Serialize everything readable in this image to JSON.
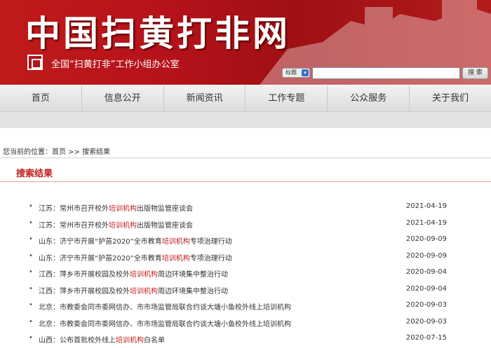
{
  "header": {
    "site_title": "中国扫黄打非网",
    "subtitle": "全国“扫黄打非”工作小组办公室",
    "search_scope": "标题",
    "search_value": "",
    "search_button": "搜 索"
  },
  "nav": [
    "首页",
    "信息公开",
    "新闻资讯",
    "工作专题",
    "公众服务",
    "关于我们"
  ],
  "breadcrumb": "您当前的位置：首页 >> 搜索结果",
  "section_title": "搜索结果",
  "results": [
    {
      "pre": "江苏：常州市召开校外",
      "hl": "培训机构",
      "post": "出版物监管座谈会",
      "date": "2021-04-19"
    },
    {
      "pre": "江苏：常州市召开校外",
      "hl": "培训机构",
      "post": "出版物监管座谈会",
      "date": "2021-04-19"
    },
    {
      "pre": "山东：济宁市开展“护苗2020”全市教育",
      "hl": "培训机构",
      "post": "专项治理行动",
      "date": "2020-09-09"
    },
    {
      "pre": "山东：济宁市开展“护苗2020”全市教育",
      "hl": "培训机构",
      "post": "专项治理行动",
      "date": "2020-09-09"
    },
    {
      "pre": "江西：萍乡市开展校园及校外",
      "hl": "培训机构",
      "post": "周边环境集中整治行动",
      "date": "2020-09-04"
    },
    {
      "pre": "江西：萍乡市开展校园及校外",
      "hl": "培训机构",
      "post": "周边环境集中整治行动",
      "date": "2020-09-04"
    },
    {
      "pre": "北京：市教委会同市委网信办、市市场监管局联合约谈大塘小鱼校外线上培训机构",
      "hl": "",
      "post": "",
      "date": "2020-09-03"
    },
    {
      "pre": "北京：市教委会同市委网信办、市市场监管局联合约谈大塘小鱼校外线上培训机构",
      "hl": "",
      "post": "",
      "date": "2020-09-03"
    },
    {
      "pre": "山西：公布首批校外线上",
      "hl": "培训机构",
      "post": "白名单",
      "date": "2020-07-15"
    }
  ]
}
